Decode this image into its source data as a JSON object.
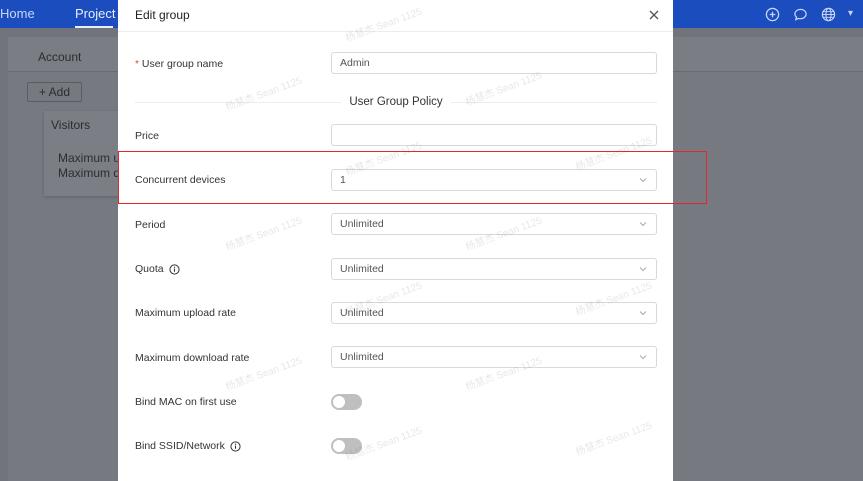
{
  "topnav": {
    "home_label": "Home",
    "project_label": "Project",
    "icons": [
      "plus-circle-icon",
      "chat-icon",
      "globe-icon"
    ]
  },
  "background": {
    "tab_account": "Account",
    "add_button": "+ Add",
    "card_title": "Visitors",
    "card_line1": "Maximum u",
    "card_line2": "Maximum d"
  },
  "modal": {
    "title": "Edit group",
    "close_icon": "close-icon",
    "group_name": {
      "required_mark": "*",
      "label": "User group name",
      "value": "Admin"
    },
    "section_title": "User Group Policy",
    "price": {
      "label": "Price",
      "value": ""
    },
    "concurrent_devices": {
      "label": "Concurrent devices",
      "value": "1"
    },
    "period": {
      "label": "Period",
      "value": "Unlimited"
    },
    "quota": {
      "label": "Quota",
      "value": "Unlimited"
    },
    "max_upload": {
      "label": "Maximum upload rate",
      "value": "Unlimited"
    },
    "max_download": {
      "label": "Maximum download rate",
      "value": "Unlimited"
    },
    "bind_mac": {
      "label": "Bind MAC on first use",
      "enabled": false
    },
    "bind_ssid": {
      "label": "Bind SSID/Network",
      "enabled": false
    }
  },
  "watermark_text": "杨慧杰 Sean 1125",
  "colors": {
    "topbar": "#1b4dbf",
    "highlight": "#e0282e",
    "required": "#e0433d"
  }
}
